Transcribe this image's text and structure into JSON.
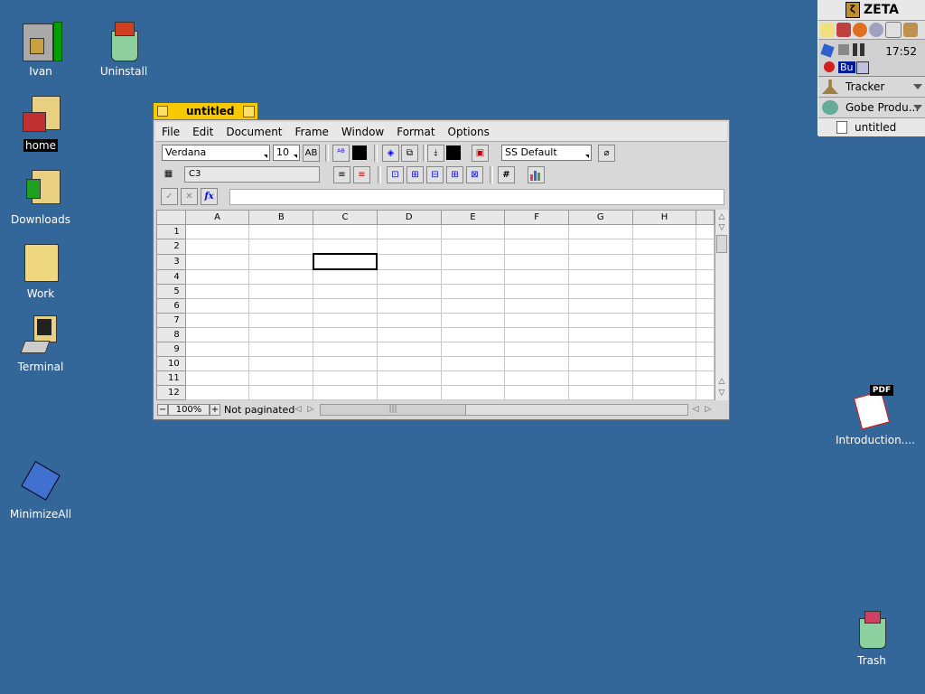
{
  "desktop": {
    "icons": [
      {
        "label": "Ivan"
      },
      {
        "label": "Uninstall"
      },
      {
        "label": "home"
      },
      {
        "label": "Downloads"
      },
      {
        "label": "Work"
      },
      {
        "label": "Terminal"
      },
      {
        "label": "MinimizeAll"
      },
      {
        "label": "Introduction...."
      },
      {
        "label": "Trash"
      }
    ],
    "pdf_badge": "PDF"
  },
  "deskbar": {
    "brand": "ZETA",
    "clock": "17:52",
    "bu_label": "Bu",
    "apps": [
      {
        "label": "Tracker"
      },
      {
        "label": "Gobe Produ..."
      }
    ],
    "sub_items": [
      {
        "label": "untitled"
      }
    ]
  },
  "window": {
    "title": "untitled",
    "menu": [
      "File",
      "Edit",
      "Document",
      "Frame",
      "Window",
      "Format",
      "Options"
    ],
    "toolbar": {
      "font": "Verdana",
      "size": "10",
      "style": "SS Default",
      "cell_ref": "C3",
      "formula": "",
      "accept_glyph": "✓",
      "cancel_glyph": "✕",
      "fx_glyph": "fx",
      "hash_glyph": "#"
    },
    "grid": {
      "columns": [
        "A",
        "B",
        "C",
        "D",
        "E",
        "F",
        "G",
        "H"
      ],
      "rows": [
        "1",
        "2",
        "3",
        "4",
        "5",
        "6",
        "7",
        "8",
        "9",
        "10",
        "11",
        "12"
      ],
      "selected_cell": "C3"
    },
    "status": {
      "zoom": "100%",
      "pagination": "Not paginated",
      "zoom_minus": "−",
      "zoom_plus": "+"
    }
  },
  "colors": {
    "desktop": "#336699",
    "tab": "#f8c800",
    "window": "#d8d8d8"
  }
}
